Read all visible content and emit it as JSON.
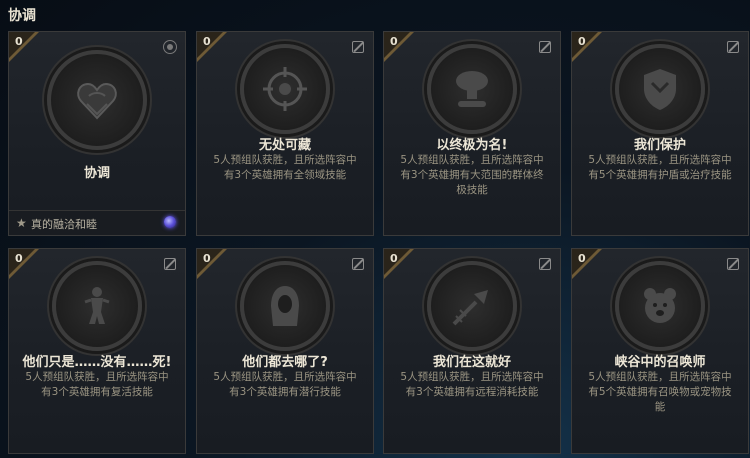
{
  "section": {
    "title": "协调"
  },
  "cards": [
    {
      "count": "0",
      "title": "协调",
      "reward": "真的融洽和睦",
      "featured": true,
      "icon": "heart-emblem-icon"
    },
    {
      "count": "0",
      "title": "无处可藏",
      "desc": "5人预组队获胜，且所选阵容中有3个英雄拥有全领域技能",
      "icon": "crosshair-icon"
    },
    {
      "count": "0",
      "title": "以终极为名!",
      "desc": "5人预组队获胜，且所选阵容中有3个英雄拥有大范围的群体终极技能",
      "icon": "mushroom-cloud-icon"
    },
    {
      "count": "0",
      "title": "我们保护",
      "desc": "5人预组队获胜，且所选阵容中有5个英雄拥有护盾或治疗技能",
      "icon": "shield-crest-icon"
    },
    {
      "count": "0",
      "title": "他们只是……没有……死!",
      "desc": "5人预组队获胜，且所选阵容中有3个英雄拥有复活技能",
      "icon": "resurrect-figure-icon"
    },
    {
      "count": "0",
      "title": "他们都去哪了?",
      "desc": "5人预组队获胜，且所选阵容中有3个英雄拥有潜行技能",
      "icon": "hooded-figure-icon"
    },
    {
      "count": "0",
      "title": "我们在这就好",
      "desc": "5人预组队获胜，且所选阵容中有3个英雄拥有远程消耗技能",
      "icon": "projectile-icon"
    },
    {
      "count": "0",
      "title": "峡谷中的召唤师",
      "desc": "5人预组队获胜，且所选阵容中有5个英雄拥有召唤物或宠物技能",
      "icon": "bear-icon"
    }
  ]
}
